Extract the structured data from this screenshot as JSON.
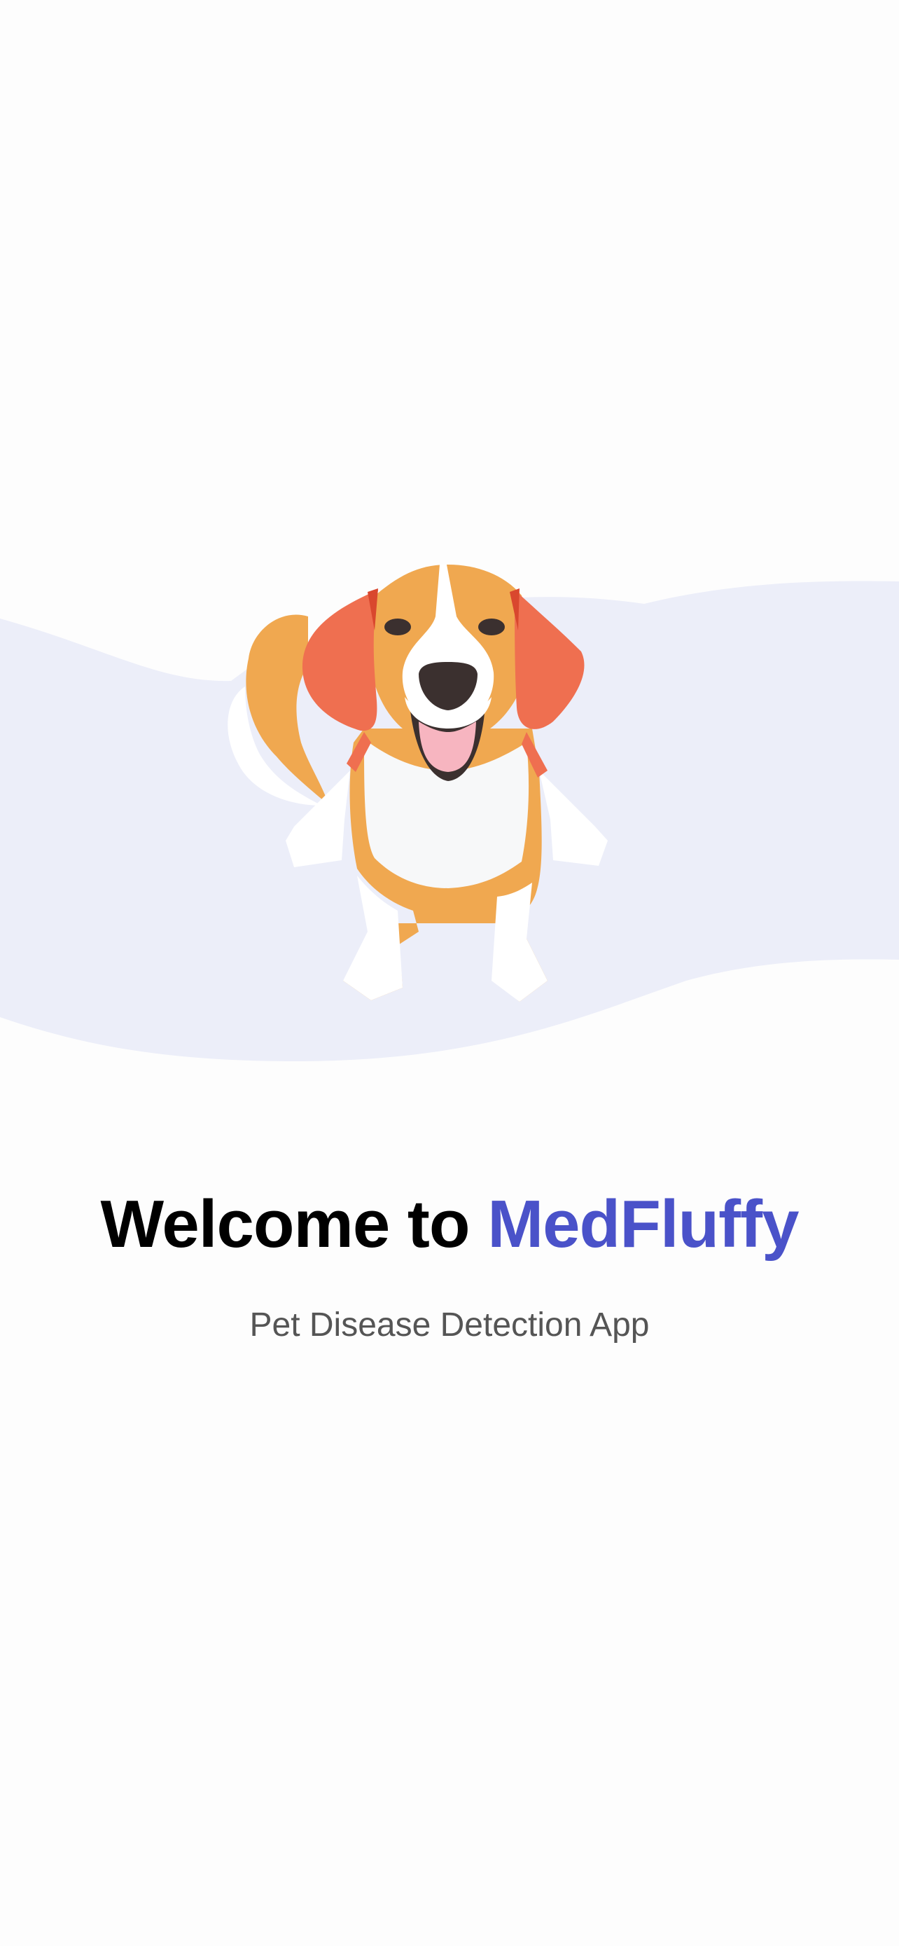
{
  "welcome": {
    "title_prefix": "Welcome to",
    "brand_name": "MedFluffy",
    "subtitle": "Pet Disease Detection App"
  },
  "hero": {
    "illustration": "beagle-dog-icon"
  },
  "colors": {
    "background": "#fdfdfd",
    "wave": "#eceef9",
    "brand_accent": "#4a52c9",
    "title_text": "#000000",
    "subtitle_text": "#555555",
    "dog_tan": "#f0a850",
    "dog_ear": "#ef6f50",
    "dog_white": "#ffffff",
    "dog_nose": "#3b302f",
    "dog_tongue": "#f7b5c0"
  }
}
